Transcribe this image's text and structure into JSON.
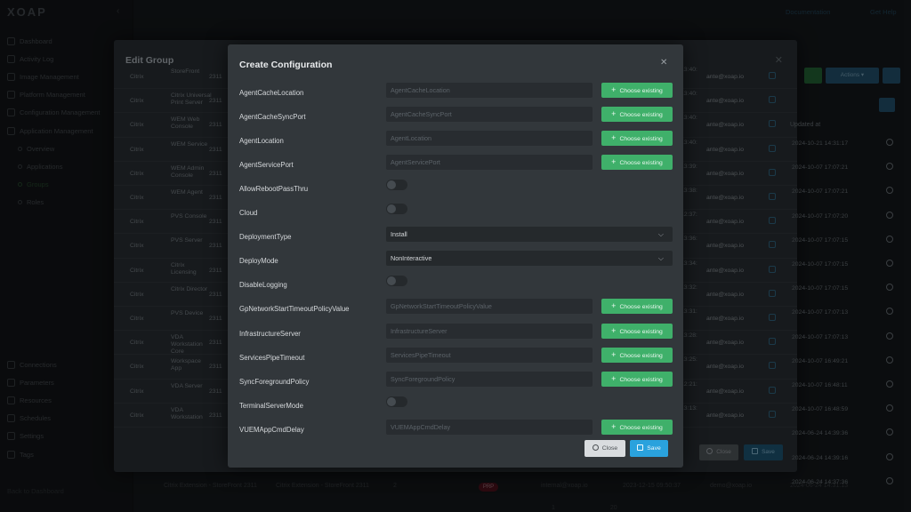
{
  "app": {
    "logo": "XOAP"
  },
  "sidebar": {
    "items": [
      {
        "label": "Dashboard",
        "sub": false
      },
      {
        "label": "Activity Log",
        "sub": false
      },
      {
        "label": "Image Management",
        "sub": false
      },
      {
        "label": "Platform Management",
        "sub": false
      },
      {
        "label": "Configuration Management",
        "sub": false
      },
      {
        "label": "Application Management",
        "sub": false
      },
      {
        "label": "Overview",
        "sub": true
      },
      {
        "label": "Applications",
        "sub": true
      },
      {
        "label": "Groups",
        "sub": true,
        "active": true
      },
      {
        "label": "Roles",
        "sub": true
      }
    ],
    "bottom_items": [
      "Connections",
      "Parameters",
      "Resources",
      "Schedules",
      "Settings",
      "Tags"
    ],
    "back_link": "Back to Dashboard"
  },
  "topbar": {
    "documentation": "Documentation",
    "get_help": "Get Help"
  },
  "background": {
    "row": {
      "name": "Citrix Extension - StoreFront 2311",
      "package": "Citrix Extension - StoreFront 2311",
      "count": "2",
      "badge": "PRP",
      "owner": "internal@xoap.io",
      "created": "2023-12-15 09:50:37",
      "user": "demo@xoap.io",
      "updated": "2024-06-24 14:31:13"
    },
    "pager": {
      "page": "1",
      "per_page": "20"
    }
  },
  "edit_group": {
    "title": "Edit Group",
    "updated_header": "Updated at",
    "actions_label": "Actions",
    "close_label": "Close",
    "save_label": "Save",
    "rows": [
      {
        "vendor": "Citrix",
        "product": "StoreFront",
        "version": "2311",
        "time": "13:40:",
        "user": "ante@xoap.io"
      },
      {
        "vendor": "Citrix",
        "product": "Citrix Universal Print Server",
        "version": "2311",
        "time": "13:40:",
        "user": "ante@xoap.io"
      },
      {
        "vendor": "Citrix",
        "product": "WEM Web Console",
        "version": "2311",
        "time": "13:40:",
        "user": "ante@xoap.io"
      },
      {
        "vendor": "Citrix",
        "product": "WEM Service",
        "version": "2311",
        "time": "13:40:",
        "user": "ante@xoap.io"
      },
      {
        "vendor": "Citrix",
        "product": "WEM Admin Console",
        "version": "2311",
        "time": "13:39:",
        "user": "ante@xoap.io"
      },
      {
        "vendor": "Citrix",
        "product": "WEM Agent",
        "version": "2311",
        "time": "13:38:",
        "user": "ante@xoap.io"
      },
      {
        "vendor": "Citrix",
        "product": "PVS Console",
        "version": "2311",
        "time": "12:37:",
        "user": "ante@xoap.io"
      },
      {
        "vendor": "Citrix",
        "product": "PVS Server",
        "version": "2311",
        "time": "13:36:",
        "user": "ante@xoap.io"
      },
      {
        "vendor": "Citrix",
        "product": "Citrix Licensing",
        "version": "2311",
        "time": "13:34:",
        "user": "ante@xoap.io"
      },
      {
        "vendor": "Citrix",
        "product": "Citrix Director",
        "version": "2311",
        "time": "13:32:",
        "user": "ante@xoap.io"
      },
      {
        "vendor": "Citrix",
        "product": "PVS Device",
        "version": "2311",
        "time": "13:31:",
        "user": "ante@xoap.io"
      },
      {
        "vendor": "Citrix",
        "product": "VDA Workstation Core",
        "version": "2311",
        "time": "13:28:",
        "user": "ante@xoap.io"
      },
      {
        "vendor": "Citrix",
        "product": "Workspace App",
        "version": "2311",
        "time": "13:25:",
        "user": "ante@xoap.io"
      },
      {
        "vendor": "Citrix",
        "product": "VDA Server",
        "version": "2311",
        "time": "12:21:",
        "user": "ante@xoap.io"
      },
      {
        "vendor": "Citrix",
        "product": "VDA Workstation",
        "version": "2311",
        "time": "13:13:",
        "user": "ante@xoap.io"
      }
    ],
    "updated_times": [
      "2024-10-21 14:31:17",
      "2024-10-07 17:07:21",
      "2024-10-07 17:07:21",
      "2024-10-07 17:07:20",
      "2024-10-07 17:07:15",
      "2024-10-07 17:07:15",
      "2024-10-07 17:07:15",
      "2024-10-07 17:07:13",
      "2024-10-07 17:07:13",
      "2024-10-07 16:49:21",
      "2024-10-07 16:48:11",
      "2024-10-07 16:48:59",
      "2024-06-24 14:39:36",
      "2024-06-24 14:39:16",
      "2024-06-24 14:37:36"
    ]
  },
  "create_config": {
    "title": "Create Configuration",
    "choose_label": "Choose existing",
    "close_label": "Close",
    "save_label": "Save",
    "fields": [
      {
        "label": "AgentCacheLocation",
        "type": "input",
        "placeholder": "AgentCacheLocation"
      },
      {
        "label": "AgentCacheSyncPort",
        "type": "input",
        "placeholder": "AgentCacheSyncPort"
      },
      {
        "label": "AgentLocation",
        "type": "input",
        "placeholder": "AgentLocation"
      },
      {
        "label": "AgentServicePort",
        "type": "input",
        "placeholder": "AgentServicePort"
      },
      {
        "label": "AllowRebootPassThru",
        "type": "toggle"
      },
      {
        "label": "Cloud",
        "type": "toggle"
      },
      {
        "label": "DeploymentType",
        "type": "select",
        "value": "Install"
      },
      {
        "label": "DeployMode",
        "type": "select",
        "value": "NonInteractive"
      },
      {
        "label": "DisableLogging",
        "type": "toggle"
      },
      {
        "label": "GpNetworkStartTimeoutPolicyValue",
        "type": "input",
        "placeholder": "GpNetworkStartTimeoutPolicyValue"
      },
      {
        "label": "InfrastructureServer",
        "type": "input",
        "placeholder": "InfrastructureServer"
      },
      {
        "label": "ServicesPipeTimeout",
        "type": "input",
        "placeholder": "ServicesPipeTimeout"
      },
      {
        "label": "SyncForegroundPolicy",
        "type": "input",
        "placeholder": "SyncForegroundPolicy"
      },
      {
        "label": "TerminalServerMode",
        "type": "toggle"
      },
      {
        "label": "VUEMAppCmdDelay",
        "type": "input",
        "placeholder": "VUEMAppCmdDelay"
      }
    ]
  }
}
